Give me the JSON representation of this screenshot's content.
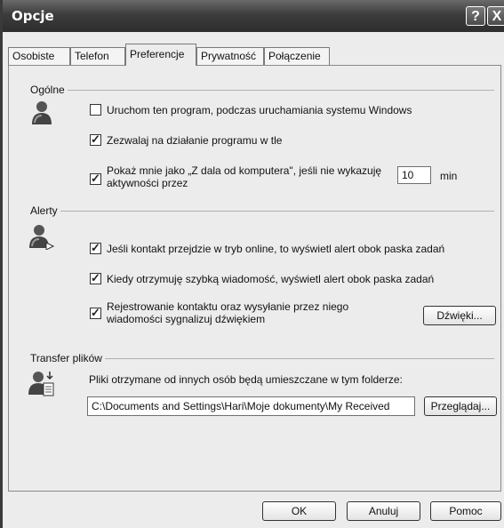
{
  "window": {
    "title": "Opcje",
    "help_glyph": "?",
    "close_glyph": "X"
  },
  "tabs": [
    {
      "label": "Osobiste"
    },
    {
      "label": "Telefon"
    },
    {
      "label": "Preferencje"
    },
    {
      "label": "Prywatność"
    },
    {
      "label": "Połączenie"
    }
  ],
  "general": {
    "title": "Ogólne",
    "startup_label": "Uruchom ten program, podczas uruchamiania systemu Windows",
    "startup_checked": false,
    "background_label": "Zezwalaj na działanie programu w tle",
    "background_checked": true,
    "away_label_line1": "Pokaż mnie jako „Z dala od komputera\", jeśli nie wykazuję",
    "away_label_line2": "aktywności przez",
    "away_checked": true,
    "away_minutes": "10",
    "away_unit": "min"
  },
  "alerts": {
    "title": "Alerty",
    "online_label": "Jeśli kontakt przejdzie w tryb online, to wyświetl alert obok paska zadań",
    "online_checked": true,
    "message_label": "Kiedy otrzymuję szybką wiadomość, wyświetl alert obok paska zadań",
    "message_checked": true,
    "sound_label_line1": "Rejestrowanie kontaktu oraz wysyłanie przez niego",
    "sound_label_line2": "wiadomości sygnalizuj dźwiękiem",
    "sound_checked": true,
    "sounds_button": "Dźwięki..."
  },
  "transfer": {
    "title": "Transfer plików",
    "description": "Pliki otrzymane od innych osób będą umieszczane w tym folderze:",
    "path": "C:\\Documents and Settings\\Hari\\Moje dokumenty\\My Received",
    "browse_button": "Przeglądaj..."
  },
  "footer": {
    "ok": "OK",
    "cancel": "Anuluj",
    "help": "Pomoc"
  }
}
